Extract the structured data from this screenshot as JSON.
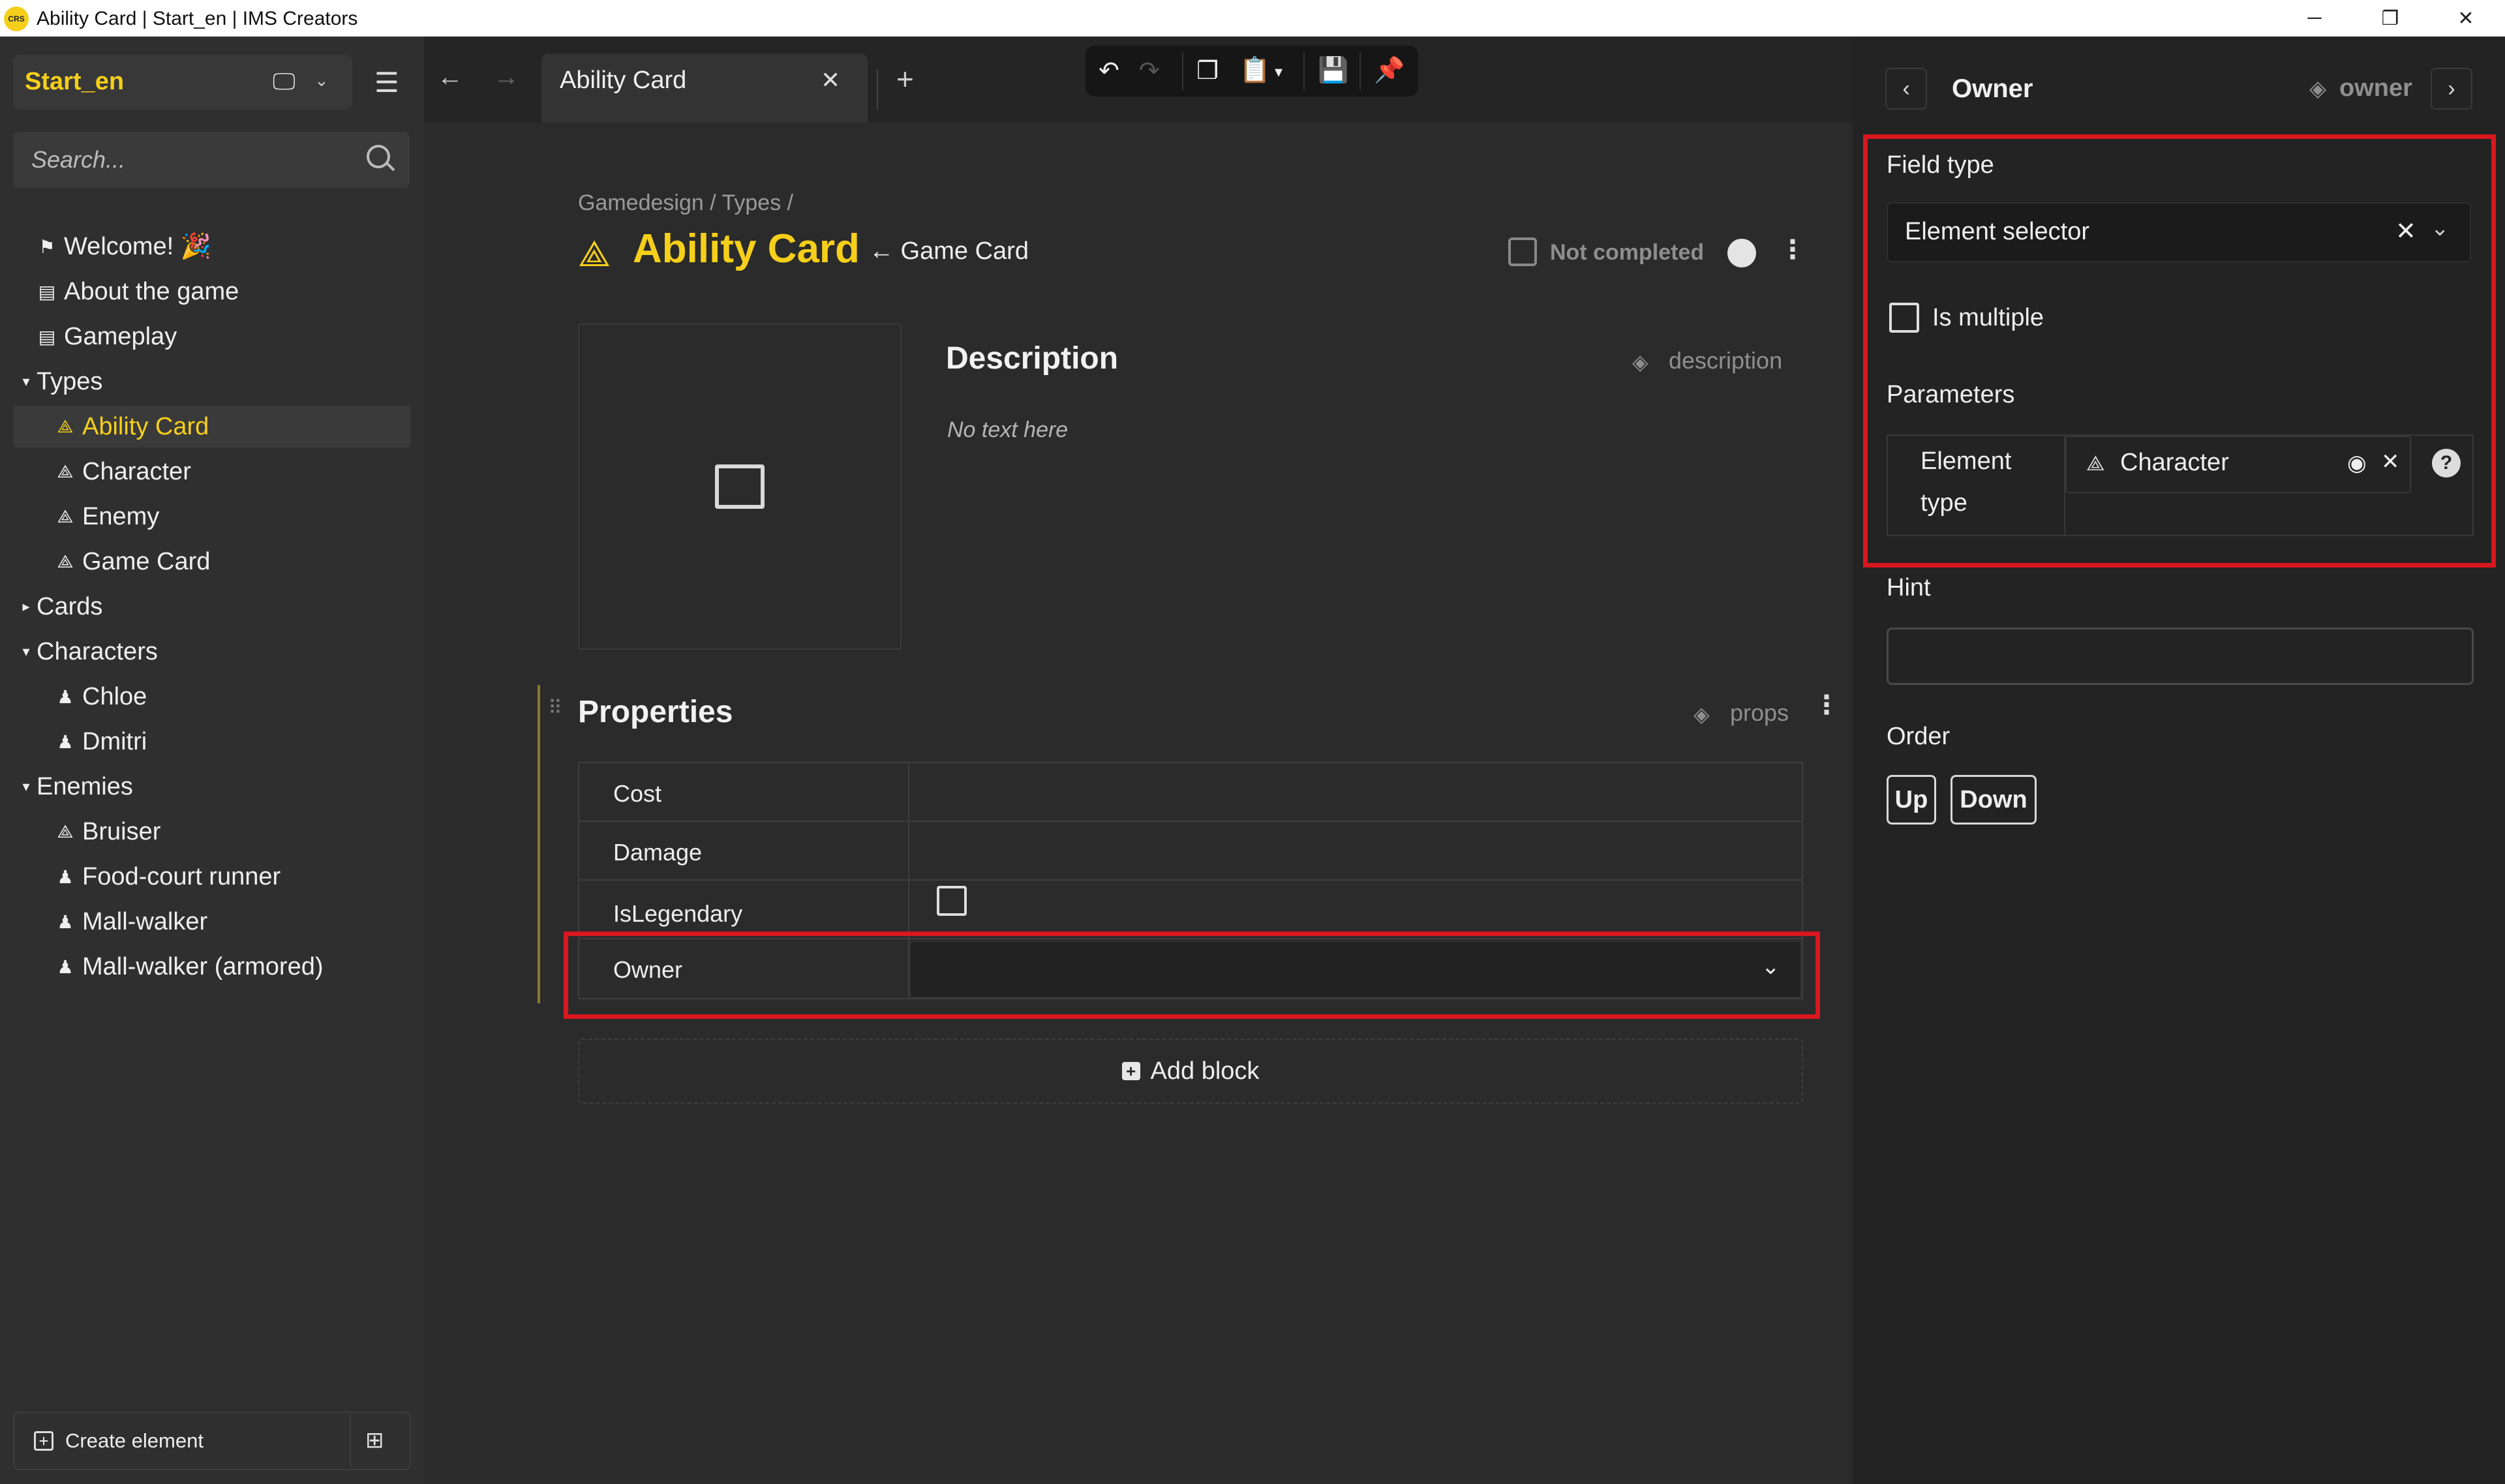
{
  "window": {
    "title": "Ability Card | Start_en | IMS Creators",
    "logo_text": "CRS",
    "minimize": "─",
    "maximize": "❐",
    "close": "✕"
  },
  "sidebar": {
    "project_name": "Start_en",
    "search_placeholder": "Search...",
    "tree": [
      {
        "label": "Welcome! 🎉",
        "icon": "flag-icon",
        "glyph": "⚑",
        "level": 0
      },
      {
        "label": "About the game",
        "icon": "document-icon",
        "glyph": "▤",
        "level": 0
      },
      {
        "label": "Gameplay",
        "icon": "document-icon",
        "glyph": "▤",
        "level": 0
      },
      {
        "label": "Types",
        "icon": "caret-down-icon",
        "glyph": "▾",
        "level": 0
      },
      {
        "label": "Ability Card",
        "icon": "shapes-icon",
        "glyph": "⟁",
        "level": 1,
        "selected": true
      },
      {
        "label": "Character",
        "icon": "shapes-icon",
        "glyph": "⟁",
        "level": 1
      },
      {
        "label": "Enemy",
        "icon": "shapes-icon",
        "glyph": "⟁",
        "level": 1
      },
      {
        "label": "Game Card",
        "icon": "shapes-icon",
        "glyph": "⟁",
        "level": 1
      },
      {
        "label": "Cards",
        "icon": "caret-right-icon",
        "glyph": "▸",
        "level": 0
      },
      {
        "label": "Characters",
        "icon": "caret-down-icon",
        "glyph": "▾",
        "level": 0
      },
      {
        "label": "Chloe",
        "icon": "avatar-icon",
        "glyph": "♟",
        "level": 1
      },
      {
        "label": "Dmitri",
        "icon": "avatar-icon",
        "glyph": "♟",
        "level": 1
      },
      {
        "label": "Enemies",
        "icon": "caret-down-icon",
        "glyph": "▾",
        "level": 0
      },
      {
        "label": "Bruiser",
        "icon": "shapes-icon",
        "glyph": "⟁",
        "level": 1
      },
      {
        "label": "Food-court runner",
        "icon": "avatar-icon",
        "glyph": "♟",
        "level": 1
      },
      {
        "label": "Mall-walker",
        "icon": "avatar-icon",
        "glyph": "♟",
        "level": 1
      },
      {
        "label": "Mall-walker (armored)",
        "icon": "avatar-icon",
        "glyph": "♟",
        "level": 1
      }
    ],
    "create_element_label": "Create element"
  },
  "tabs": {
    "active_tab": "Ability Card"
  },
  "main": {
    "breadcrumb": "Gamedesign / Types /",
    "title": "Ability Card",
    "parent_link": "← Game Card",
    "status_label": "Not completed",
    "description": {
      "heading": "Description",
      "tag": "description",
      "placeholder": "No text here"
    },
    "properties": {
      "heading": "Properties",
      "tag": "props",
      "rows": [
        {
          "name": "Cost",
          "kind": "text"
        },
        {
          "name": "Damage",
          "kind": "text"
        },
        {
          "name": "IsLegendary",
          "kind": "checkbox"
        },
        {
          "name": "Owner",
          "kind": "select"
        }
      ]
    },
    "add_block_label": "Add block"
  },
  "right_panel": {
    "title": "Owner",
    "tag": "owner",
    "field_type_label": "Field type",
    "field_type_value": "Element selector",
    "is_multiple_label": "Is multiple",
    "parameters_label": "Parameters",
    "param_name_line1": "Element",
    "param_name_line2": "type",
    "param_value": "Character",
    "hint_label": "Hint",
    "hint_value": "",
    "order_label": "Order",
    "up_label": "Up",
    "down_label": "Down"
  },
  "colors": {
    "accent": "#f5cf1a",
    "highlight": "#d8171f",
    "background": "#2b2b2b"
  }
}
